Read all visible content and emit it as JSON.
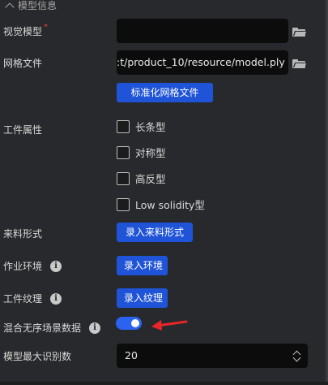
{
  "section": {
    "title": "模型信息"
  },
  "fields": {
    "visual_model": {
      "label": "视觉模型",
      "required_mark": "*",
      "value": ""
    },
    "mesh_file": {
      "label": "网格文件",
      "value": ":t/product_10/resource/model.ply",
      "button": "标准化网格文件"
    },
    "workpiece_props": {
      "label": "工件属性",
      "options": [
        {
          "label": "长条型",
          "checked": false
        },
        {
          "label": "对称型",
          "checked": false
        },
        {
          "label": "高反型",
          "checked": false
        },
        {
          "label": "Low solidity型",
          "checked": false
        }
      ]
    },
    "feed_form": {
      "label": "来料形式",
      "button": "录入来料形式"
    },
    "work_env": {
      "label": "作业环境",
      "button": "录入环境"
    },
    "work_texture": {
      "label": "工件纹理",
      "button": "录入纹理"
    },
    "mixed_data": {
      "label": "混合无序场景数据",
      "enabled": true
    },
    "max_recognition": {
      "label": "模型最大识别数",
      "value": "20"
    }
  },
  "icons": {
    "info": "i",
    "folder": "folder-icon",
    "chevron": "chevron-up-icon"
  },
  "colors": {
    "background": "#28292c",
    "button": "#1f54d8",
    "toggle_on": "#2a63f2",
    "arrow": "#e8262a",
    "required": "#e0443e"
  }
}
